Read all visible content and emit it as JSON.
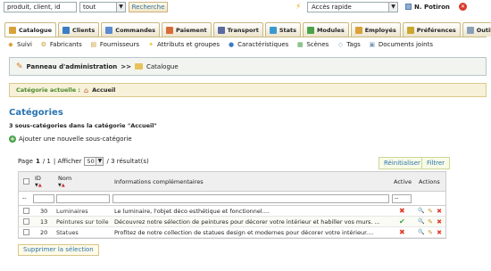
{
  "topbar": {
    "search_value": "produit, client, id",
    "search_scope": "tout",
    "search_button": "Recherche",
    "quick_access": "Accès rapide",
    "user_name": "N. Potiron"
  },
  "tabs": [
    {
      "label": "Catalogue",
      "color": "#d9a13a",
      "active": true
    },
    {
      "label": "Clients",
      "color": "#3a7cc6"
    },
    {
      "label": "Commandes",
      "color": "#5a8ad0"
    },
    {
      "label": "Paiement",
      "color": "#d96a3a"
    },
    {
      "label": "Transport",
      "color": "#5a6aa0"
    },
    {
      "label": "Stats",
      "color": "#3a9ad0"
    },
    {
      "label": "Modules",
      "color": "#4aa34a"
    },
    {
      "label": "Employés",
      "color": "#d9a13a"
    },
    {
      "label": "Préférences",
      "color": "#c9a830"
    },
    {
      "label": "Outils",
      "color": "#8aa0b8"
    }
  ],
  "subtabs": [
    {
      "label": "Suivi",
      "icon": "◆",
      "color": "#d9a13a"
    },
    {
      "label": "Fabricants",
      "icon": "⚙",
      "color": "#c8952a"
    },
    {
      "label": "Fournisseurs",
      "icon": "▤",
      "color": "#c8952a"
    },
    {
      "label": "Attributs et groupes",
      "icon": "✦",
      "color": "#e9c23a"
    },
    {
      "label": "Caractéristiques",
      "icon": "●",
      "color": "#3a7cc6"
    },
    {
      "label": "Scènes",
      "icon": "▦",
      "color": "#4aa34a"
    },
    {
      "label": "Tags",
      "icon": "◇",
      "color": "#8aa0b8"
    },
    {
      "label": "Documents joints",
      "icon": "▣",
      "color": "#7a9ab8"
    }
  ],
  "breadcrumb": {
    "root": "Panneau d'administration",
    "separator": ">>",
    "current": "Catalogue"
  },
  "current_category": {
    "label": "Catégorie actuelle :",
    "value": "Accueil"
  },
  "section_title": "Catégories",
  "subcategory_count": "3 sous-catégories dans la catégorie \"Accueil\"",
  "add_link": "Ajouter une nouvelle sous-catégorie",
  "pagination": {
    "page_label": "Page",
    "page": "1",
    "slash_total": "/ 1",
    "display_label": "| Afficher",
    "per_page": "50",
    "results": "/ 3 résultat(s)"
  },
  "buttons": {
    "reset": "Réinitialiser",
    "filter": "Filtrer",
    "delete_selection": "Supprimer la sélection"
  },
  "table": {
    "headers": {
      "id": "ID",
      "name": "Nom",
      "info": "Informations complémentaires",
      "active": "Active",
      "actions": "Actions"
    },
    "filter_placeholder": "--",
    "active_filter": "--",
    "rows": [
      {
        "id": "30",
        "name": "Luminaires",
        "info": "Le luminaire, l'objet déco esthétique et fonctionnel....",
        "active": false
      },
      {
        "id": "13",
        "name": "Peintures sur toile",
        "info": "Découvrez notre sélection de peintures pour décorer votre intérieur et habiller vos murs. ...",
        "active": true
      },
      {
        "id": "20",
        "name": "Statues",
        "info": "Profitez de notre collection de statues design et modernes pour décorer votre intérieur....",
        "active": false
      }
    ]
  }
}
